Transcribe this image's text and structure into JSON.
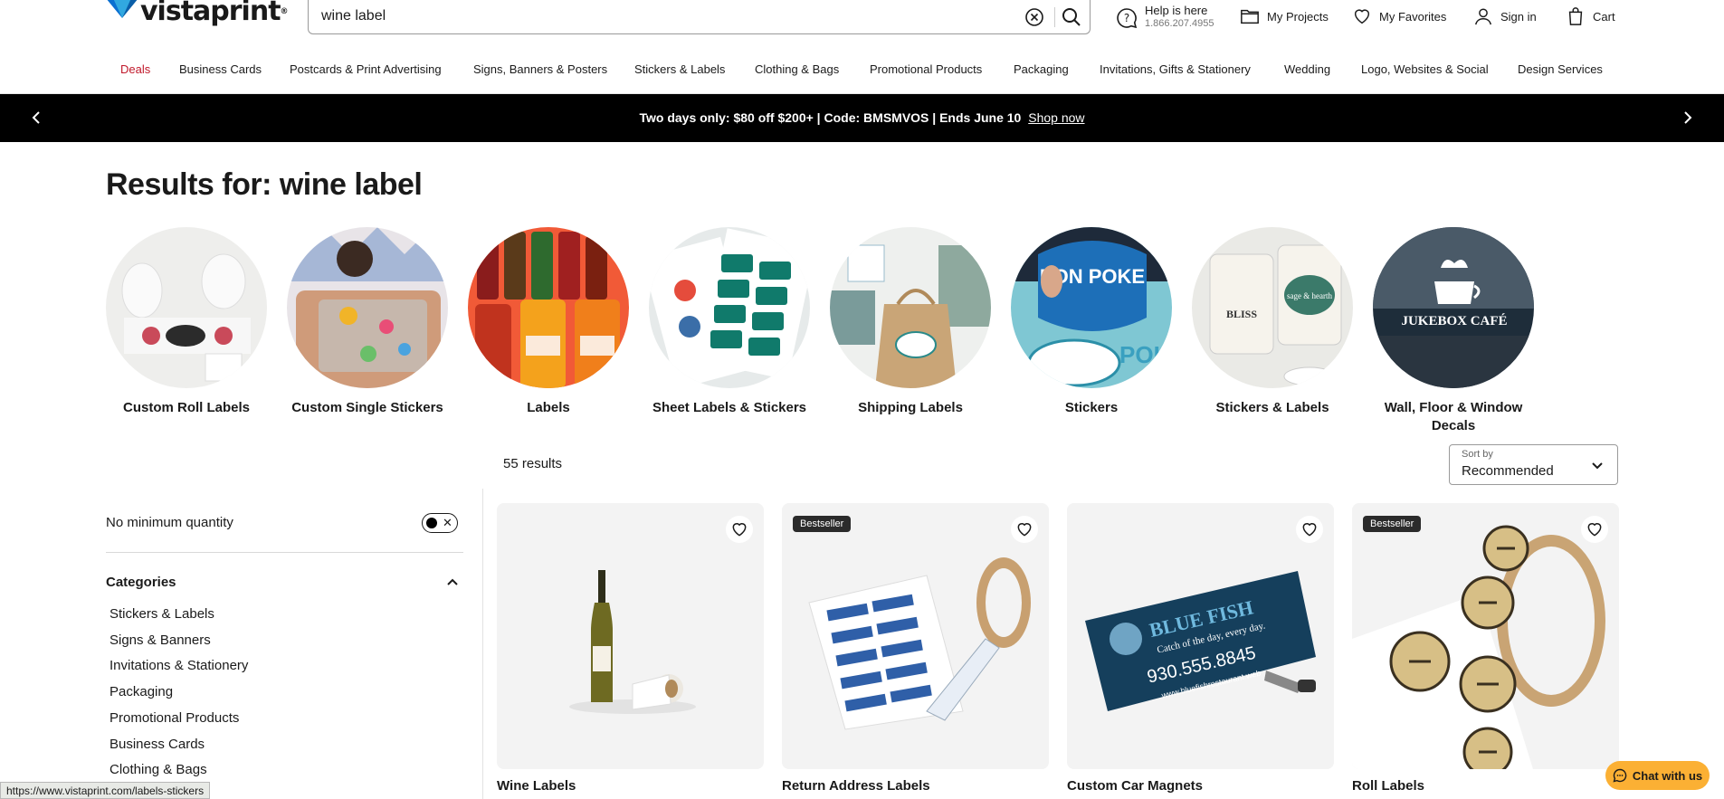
{
  "header": {
    "logo_text": "vistaprint",
    "logo_mark": "®",
    "search": {
      "value": "wine label",
      "placeholder": "Search"
    },
    "help": {
      "title": "Help is here",
      "phone": "1.866.207.4955"
    },
    "links": {
      "projects": "My Projects",
      "favorites": "My Favorites",
      "signin": "Sign in",
      "cart": "Cart"
    }
  },
  "nav": [
    "Deals",
    "Business Cards",
    "Postcards & Print Advertising",
    "Signs, Banners & Posters",
    "Stickers & Labels",
    "Clothing & Bags",
    "Promotional Products",
    "Packaging",
    "Invitations, Gifts & Stationery",
    "Wedding",
    "Logo, Websites & Social",
    "Design Services"
  ],
  "promo": {
    "text": "Two days only: $80 off $200+ | Code: BMSMVOS | Ends June 10",
    "link": "Shop now"
  },
  "results": {
    "title": "Results for: wine label",
    "count": "55 results",
    "sort_label": "Sort by",
    "sort_value": "Recommended"
  },
  "categories": [
    "Custom Roll Labels",
    "Custom Single Stickers",
    "Labels",
    "Sheet Labels & Stickers",
    "Shipping Labels",
    "Stickers",
    "Stickers & Labels",
    "Wall, Floor & Window Decals"
  ],
  "category_images": {
    "circle_6_text": "PON POKE",
    "circle_6_text_b": "POK",
    "circle_7_brand": "sage & hearth",
    "circle_7_word": "BLISS",
    "circle_8_sign": "JUKEBOX CAFÉ"
  },
  "sidebar": {
    "min_qty_label": "No minimum quantity",
    "categories_heading": "Categories",
    "items": [
      "Stickers & Labels",
      "Signs & Banners",
      "Invitations & Stationery",
      "Packaging",
      "Promotional Products",
      "Business Cards",
      "Clothing & Bags"
    ]
  },
  "products": [
    {
      "title": "Wine Labels",
      "badge": ""
    },
    {
      "title": "Return Address Labels",
      "badge": "Bestseller"
    },
    {
      "title": "Custom Car Magnets",
      "badge": ""
    },
    {
      "title": "Roll Labels",
      "badge": "Bestseller"
    }
  ],
  "product_images": {
    "magnet_brand": "BLUE FISH",
    "magnet_tagline": "Catch of the day, every day.",
    "magnet_phone": "930.555.8845",
    "magnet_url": "www.bluefishrestaurant.web"
  },
  "status_url": "https://www.vistaprint.com/labels-stickers",
  "chat_label": "Chat with us",
  "colors": {
    "deals": "#c0192b",
    "promo_bg": "#000000",
    "chat_bg": "#fbb034",
    "brand_blue": "#0a5ea8"
  }
}
